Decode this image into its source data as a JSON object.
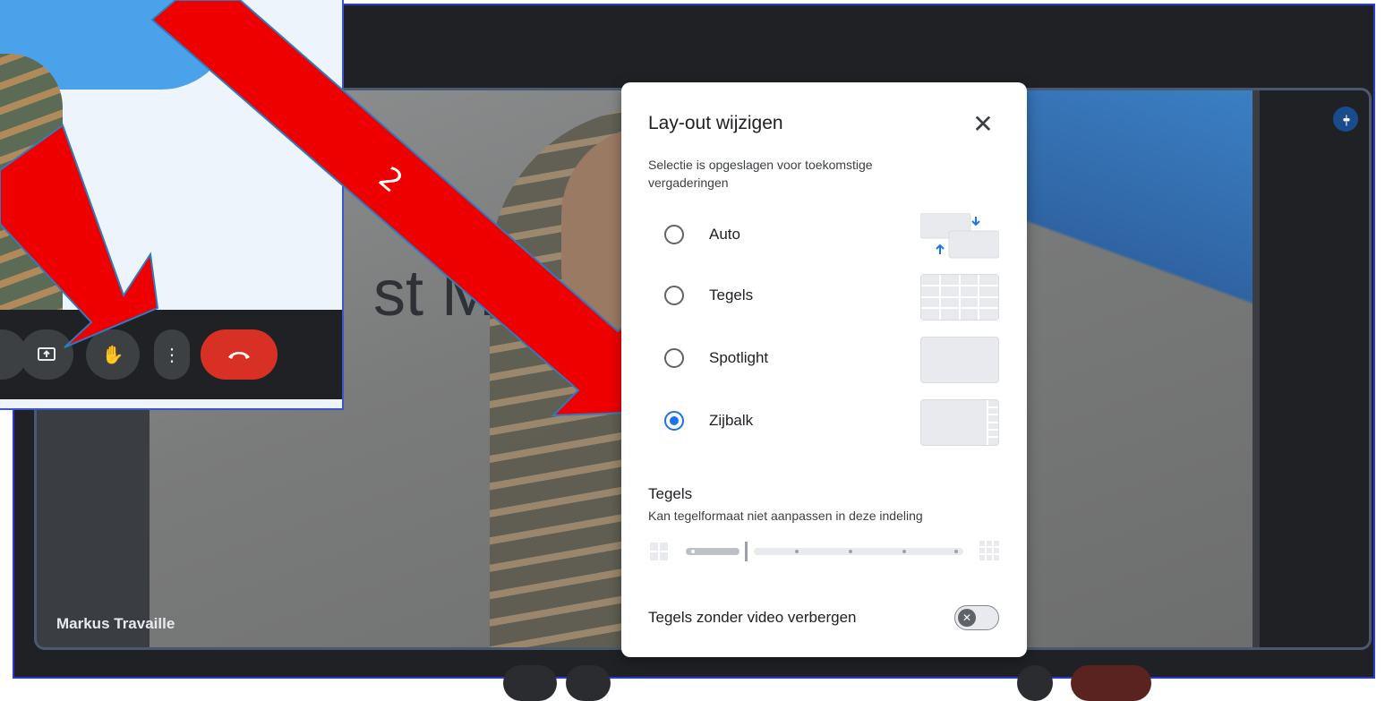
{
  "meeting": {
    "participant_name": "Markus Travaille",
    "slide_text": "st M"
  },
  "dialog": {
    "title": "Lay-out wijzigen",
    "close_label": "✕",
    "subtitle": "Selectie is opgeslagen voor toekomstige vergaderingen",
    "options": [
      {
        "label": "Auto",
        "selected": false
      },
      {
        "label": "Tegels",
        "selected": false
      },
      {
        "label": "Spotlight",
        "selected": false
      },
      {
        "label": "Zijbalk",
        "selected": true
      }
    ],
    "tiles_section": {
      "title": "Tegels",
      "description": "Kan tegelformaat niet aanpassen in deze indeling"
    },
    "toggle": {
      "label": "Tegels zonder video verbergen",
      "on": false
    }
  },
  "annotation": {
    "arrow_number": "2"
  },
  "colors": {
    "accent": "#1a73e8",
    "end_call": "#d93025",
    "arrow": "#ee0000",
    "meet_bg": "#202124"
  },
  "icons": {
    "present": "present-screen-icon",
    "hand": "raise-hand-icon",
    "more": "more-vert-icon",
    "end_call": "end-call-icon",
    "close": "close-icon",
    "speaker": "audio-level-icon"
  }
}
